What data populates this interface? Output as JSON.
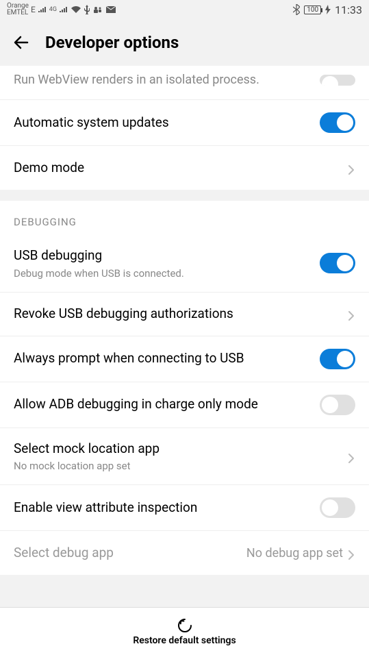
{
  "status": {
    "carrier1": "Orange",
    "carrier2": "EMTEL",
    "net_indicator": "E",
    "net_4g": "4G",
    "battery": "100",
    "time": "11:33"
  },
  "header": {
    "title": "Developer options"
  },
  "partial_row": {
    "text": "Run WebView renders in an isolated process."
  },
  "rows_top": [
    {
      "title": "Automatic system updates",
      "ctrl": "toggle",
      "on": true
    },
    {
      "title": "Demo mode",
      "ctrl": "chevron"
    }
  ],
  "section": {
    "label": "DEBUGGING"
  },
  "rows_debug": [
    {
      "title": "USB debugging",
      "sub": "Debug mode when USB is connected.",
      "ctrl": "toggle",
      "on": true
    },
    {
      "title": "Revoke USB debugging authorizations",
      "ctrl": "chevron"
    },
    {
      "title": "Always prompt when connecting to USB",
      "ctrl": "toggle",
      "on": true
    },
    {
      "title": "Allow ADB debugging in charge only mode",
      "ctrl": "toggle",
      "on": false
    },
    {
      "title": "Select mock location app",
      "sub": "No mock location app set",
      "ctrl": "chevron"
    },
    {
      "title": "Enable view attribute inspection",
      "ctrl": "toggle",
      "on": false
    },
    {
      "title": "Select debug app",
      "value": "No debug app set",
      "ctrl": "chevron",
      "disabled": true
    }
  ],
  "footer": {
    "label": "Restore default settings"
  }
}
